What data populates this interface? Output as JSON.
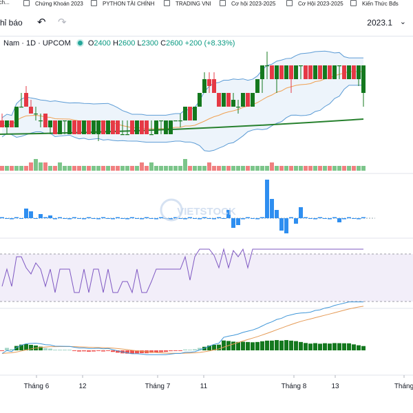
{
  "browser_bookmarks": [
    {
      "label": "...ch..."
    },
    {
      "label": "Chứng Khoán 2023"
    },
    {
      "label": "PYTHON TÀI CHÍNH"
    },
    {
      "label": "TRADING VNI"
    },
    {
      "label": "Cơ hội 2023-2025"
    },
    {
      "label": "Cơ Hội 2023-2025"
    },
    {
      "label": "Kiến Thức Bđs"
    }
  ],
  "toolbar": {
    "left_label": "hỉ báo",
    "undo_icon": "undo-arrow-icon",
    "redo_icon": "redo-arrow-icon",
    "date_value": "2023.1",
    "date_icon": "chevron-down-icon"
  },
  "legend": {
    "symbol": "Nam · 1D · UPCOM",
    "o_key": "O",
    "o_val": "2400",
    "h_key": "H",
    "h_val": "2600",
    "l_key": "L",
    "l_val": "2300",
    "c_key": "C",
    "c_val": "2600",
    "change": "+200 (+8.33%)"
  },
  "watermark": "VIETSTOCK",
  "colors": {
    "up": "#14781e",
    "down": "#e53945",
    "bb": "#5b9bd5",
    "ma": "#26802d",
    "ma_short": "#f0a050",
    "vol_up": "#7cc58a",
    "vol_down": "#f08080",
    "flow": "#2e8ef0",
    "rsi": "#7e57c2",
    "macd": "#3f96d8",
    "signal": "#e59a55",
    "hist_up_strong": "#14781e",
    "hist_up_weak": "#a5d6c8",
    "hist_down": "#ef5350"
  },
  "chart_data": {
    "type": "candlestick",
    "x_axis_labels": [
      "Tháng 6",
      "12",
      "Tháng 7",
      "11",
      "Tháng 8",
      "13",
      "Tháng"
    ],
    "price_candles": [
      {
        "o": 2200,
        "h": 2250,
        "l": 2150,
        "c": 2150
      },
      {
        "o": 2150,
        "h": 2200,
        "l": 2100,
        "c": 2200
      },
      {
        "o": 2200,
        "h": 2200,
        "l": 2150,
        "c": 2150
      },
      {
        "o": 2150,
        "h": 2300,
        "l": 2150,
        "c": 2300
      },
      {
        "o": 2300,
        "h": 2400,
        "l": 2300,
        "c": 2300
      },
      {
        "o": 2400,
        "h": 2450,
        "l": 2300,
        "c": 2300
      },
      {
        "o": 2300,
        "h": 2350,
        "l": 2250,
        "c": 2250
      },
      {
        "o": 2250,
        "h": 2300,
        "l": 2200,
        "c": 2250
      },
      {
        "o": 2200,
        "h": 2250,
        "l": 2150,
        "c": 2200
      },
      {
        "o": 2250,
        "h": 2250,
        "l": 2150,
        "c": 2150
      },
      {
        "o": 2150,
        "h": 2200,
        "l": 2100,
        "c": 2200
      },
      {
        "o": 2200,
        "h": 2200,
        "l": 2100,
        "c": 2100
      },
      {
        "o": 2100,
        "h": 2200,
        "l": 2100,
        "c": 2200
      },
      {
        "o": 2200,
        "h": 2200,
        "l": 2100,
        "c": 2200
      },
      {
        "o": 2100,
        "h": 2200,
        "l": 2100,
        "c": 2200
      },
      {
        "o": 2200,
        "h": 2200,
        "l": 2100,
        "c": 2100
      },
      {
        "o": 2200,
        "h": 2200,
        "l": 2100,
        "c": 2100
      },
      {
        "o": 2100,
        "h": 2200,
        "l": 2100,
        "c": 2200
      },
      {
        "o": 2200,
        "h": 2200,
        "l": 2100,
        "c": 2100
      },
      {
        "o": 2100,
        "h": 2200,
        "l": 2100,
        "c": 2200
      },
      {
        "o": 2100,
        "h": 2200,
        "l": 2050,
        "c": 2200
      },
      {
        "o": 2200,
        "h": 2200,
        "l": 2100,
        "c": 2100
      },
      {
        "o": 2100,
        "h": 2200,
        "l": 2100,
        "c": 2200
      },
      {
        "o": 2200,
        "h": 2200,
        "l": 2100,
        "c": 2100
      },
      {
        "o": 2200,
        "h": 2200,
        "l": 2100,
        "c": 2100
      },
      {
        "o": 2100,
        "h": 2200,
        "l": 2100,
        "c": 2100
      },
      {
        "o": 2100,
        "h": 2200,
        "l": 2100,
        "c": 2100
      },
      {
        "o": 2200,
        "h": 2200,
        "l": 2100,
        "c": 2100
      },
      {
        "o": 2100,
        "h": 2200,
        "l": 2100,
        "c": 2200
      },
      {
        "o": 2200,
        "h": 2200,
        "l": 2100,
        "c": 2100
      },
      {
        "o": 2200,
        "h": 2200,
        "l": 2100,
        "c": 2100
      },
      {
        "o": 2100,
        "h": 2200,
        "l": 2100,
        "c": 2100
      },
      {
        "o": 2100,
        "h": 2200,
        "l": 2100,
        "c": 2200
      },
      {
        "o": 2200,
        "h": 2200,
        "l": 2100,
        "c": 2200
      },
      {
        "o": 2100,
        "h": 2200,
        "l": 2100,
        "c": 2200
      },
      {
        "o": 2100,
        "h": 2200,
        "l": 2100,
        "c": 2200
      },
      {
        "o": 2200,
        "h": 2200,
        "l": 2200,
        "c": 2200
      },
      {
        "o": 2200,
        "h": 2250,
        "l": 2150,
        "c": 2200
      },
      {
        "o": 2200,
        "h": 2300,
        "l": 2200,
        "c": 2300
      },
      {
        "o": 2300,
        "h": 2300,
        "l": 2200,
        "c": 2200
      },
      {
        "o": 2200,
        "h": 2300,
        "l": 2200,
        "c": 2300
      },
      {
        "o": 2300,
        "h": 2400,
        "l": 2300,
        "c": 2400
      },
      {
        "o": 2400,
        "h": 2550,
        "l": 2400,
        "c": 2500
      },
      {
        "o": 2500,
        "h": 2550,
        "l": 2400,
        "c": 2450
      },
      {
        "o": 2500,
        "h": 2550,
        "l": 2400,
        "c": 2400
      },
      {
        "o": 2400,
        "h": 2400,
        "l": 2300,
        "c": 2300
      },
      {
        "o": 2300,
        "h": 2400,
        "l": 2300,
        "c": 2400
      },
      {
        "o": 2400,
        "h": 2400,
        "l": 2300,
        "c": 2300
      },
      {
        "o": 2300,
        "h": 2400,
        "l": 2300,
        "c": 2350
      },
      {
        "o": 2300,
        "h": 2350,
        "l": 2250,
        "c": 2300
      },
      {
        "o": 2300,
        "h": 2400,
        "l": 2300,
        "c": 2400
      },
      {
        "o": 2400,
        "h": 2400,
        "l": 2300,
        "c": 2300
      },
      {
        "o": 2300,
        "h": 2400,
        "l": 2300,
        "c": 2400
      },
      {
        "o": 2400,
        "h": 2500,
        "l": 2400,
        "c": 2500
      },
      {
        "o": 2500,
        "h": 2600,
        "l": 2400,
        "c": 2600
      },
      {
        "o": 2600,
        "h": 2700,
        "l": 2500,
        "c": 2600
      },
      {
        "o": 2600,
        "h": 2600,
        "l": 2500,
        "c": 2500
      },
      {
        "o": 2500,
        "h": 2600,
        "l": 2400,
        "c": 2600
      },
      {
        "o": 2600,
        "h": 2600,
        "l": 2500,
        "c": 2500
      },
      {
        "o": 2500,
        "h": 2600,
        "l": 2500,
        "c": 2600
      },
      {
        "o": 2600,
        "h": 2600,
        "l": 2400,
        "c": 2500
      },
      {
        "o": 2500,
        "h": 2600,
        "l": 2500,
        "c": 2600
      },
      {
        "o": 2600,
        "h": 2600,
        "l": 2500,
        "c": 2600
      },
      {
        "o": 2600,
        "h": 2600,
        "l": 2500,
        "c": 2500
      },
      {
        "o": 2600,
        "h": 2600,
        "l": 2500,
        "c": 2500
      },
      {
        "o": 2500,
        "h": 2600,
        "l": 2500,
        "c": 2600
      },
      {
        "o": 2600,
        "h": 2600,
        "l": 2500,
        "c": 2500
      },
      {
        "o": 2500,
        "h": 2600,
        "l": 2500,
        "c": 2600
      },
      {
        "o": 2600,
        "h": 2600,
        "l": 2500,
        "c": 2500
      },
      {
        "o": 2500,
        "h": 2600,
        "l": 2500,
        "c": 2600
      },
      {
        "o": 2600,
        "h": 2600,
        "l": 2500,
        "c": 2600
      },
      {
        "o": 2600,
        "h": 2600,
        "l": 2500,
        "c": 2500
      },
      {
        "o": 2500,
        "h": 2600,
        "l": 2500,
        "c": 2600
      },
      {
        "o": 2600,
        "h": 2600,
        "l": 2500,
        "c": 2500
      },
      {
        "o": 2500,
        "h": 2600,
        "l": 2450,
        "c": 2600
      },
      {
        "o": 2400,
        "h": 2600,
        "l": 2300,
        "c": 2600
      }
    ],
    "ma_long": [
      2100,
      2180,
      2210
    ],
    "volume": [
      1,
      1,
      1,
      1,
      1,
      1,
      2,
      3,
      2,
      2,
      1,
      1,
      2,
      1,
      1,
      1,
      1,
      1,
      1,
      1,
      1,
      1,
      1,
      1,
      1,
      1,
      1,
      1,
      1,
      2,
      1,
      2,
      1,
      1,
      1,
      1,
      1,
      1,
      3,
      1,
      1,
      1,
      1,
      2,
      1,
      1,
      1,
      1,
      1,
      1,
      1,
      1,
      1,
      1,
      1,
      1,
      2,
      1,
      1,
      1,
      1,
      1,
      1,
      1,
      1,
      1,
      1,
      1,
      1,
      1,
      1,
      1,
      1,
      1,
      1,
      1,
      1,
      1
    ],
    "rsi_range": [
      0,
      100
    ]
  }
}
